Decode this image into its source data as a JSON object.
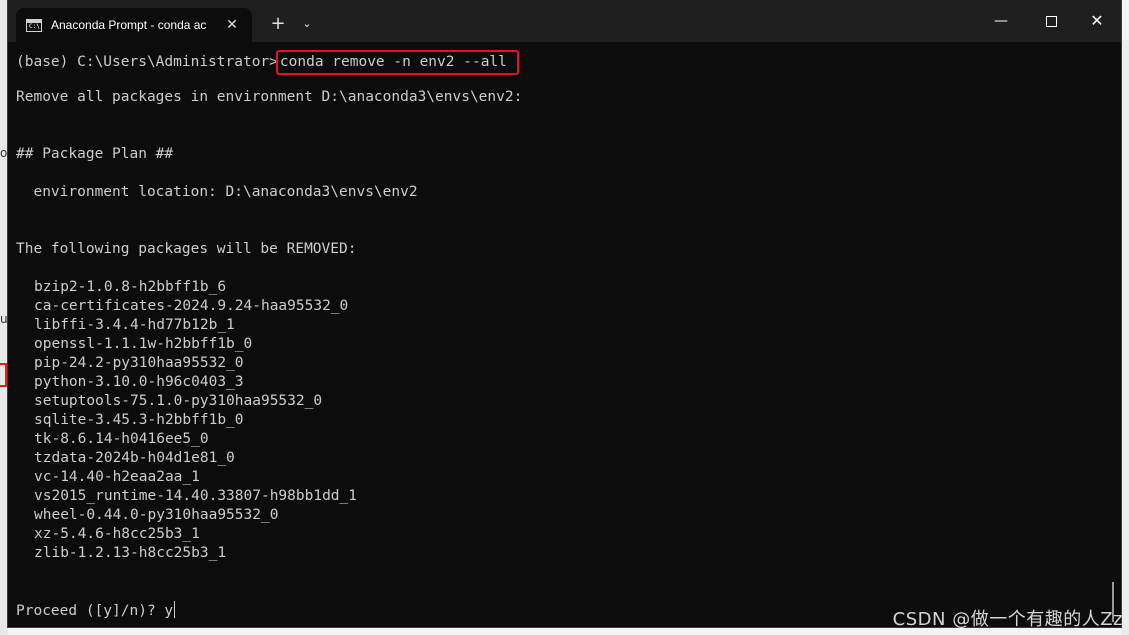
{
  "window": {
    "tab_title": "Anaconda Prompt - conda ac",
    "tab_close_glyph": "✕",
    "new_tab_glyph": "+",
    "dropdown_glyph": "⌄",
    "minimize_glyph": "—",
    "close_glyph": "✕",
    "tab_icon_glyph": "C:\\"
  },
  "terminal": {
    "prompt": "(base) C:\\Users\\Administrator>",
    "command": "conda remove -n env2 --all",
    "remove_line": "Remove all packages in environment D:\\anaconda3\\envs\\env2:",
    "plan_header": "## Package Plan ##",
    "env_location": "  environment location: D:\\anaconda3\\envs\\env2",
    "removed_header": "The following packages will be REMOVED:",
    "packages": [
      "bzip2-1.0.8-h2bbff1b_6",
      "ca-certificates-2024.9.24-haa95532_0",
      "libffi-3.4.4-hd77b12b_1",
      "openssl-1.1.1w-h2bbff1b_0",
      "pip-24.2-py310haa95532_0",
      "python-3.10.0-h96c0403_3",
      "setuptools-75.1.0-py310haa95532_0",
      "sqlite-3.45.3-h2bbff1b_0",
      "tk-8.6.14-h0416ee5_0",
      "tzdata-2024b-h04d1e81_0",
      "vc-14.40-h2eaa2aa_1",
      "vs2015_runtime-14.40.33807-h98bb1dd_1",
      "wheel-0.44.0-py310haa95532_0",
      "xz-5.4.6-h8cc25b3_1",
      "zlib-1.2.13-h8cc25b3_1"
    ],
    "proceed_prompt": "Proceed ([y]/n)? y"
  },
  "background": {
    "left_marks": [
      "ol",
      "u"
    ]
  },
  "watermark": "CSDN @做一个有趣的人Zz",
  "colors": {
    "terminal_bg": "#0c0c0c",
    "terminal_text": "#cccccc",
    "highlight_border": "#e81123",
    "titlebar_bg": "#1f1f1f"
  }
}
